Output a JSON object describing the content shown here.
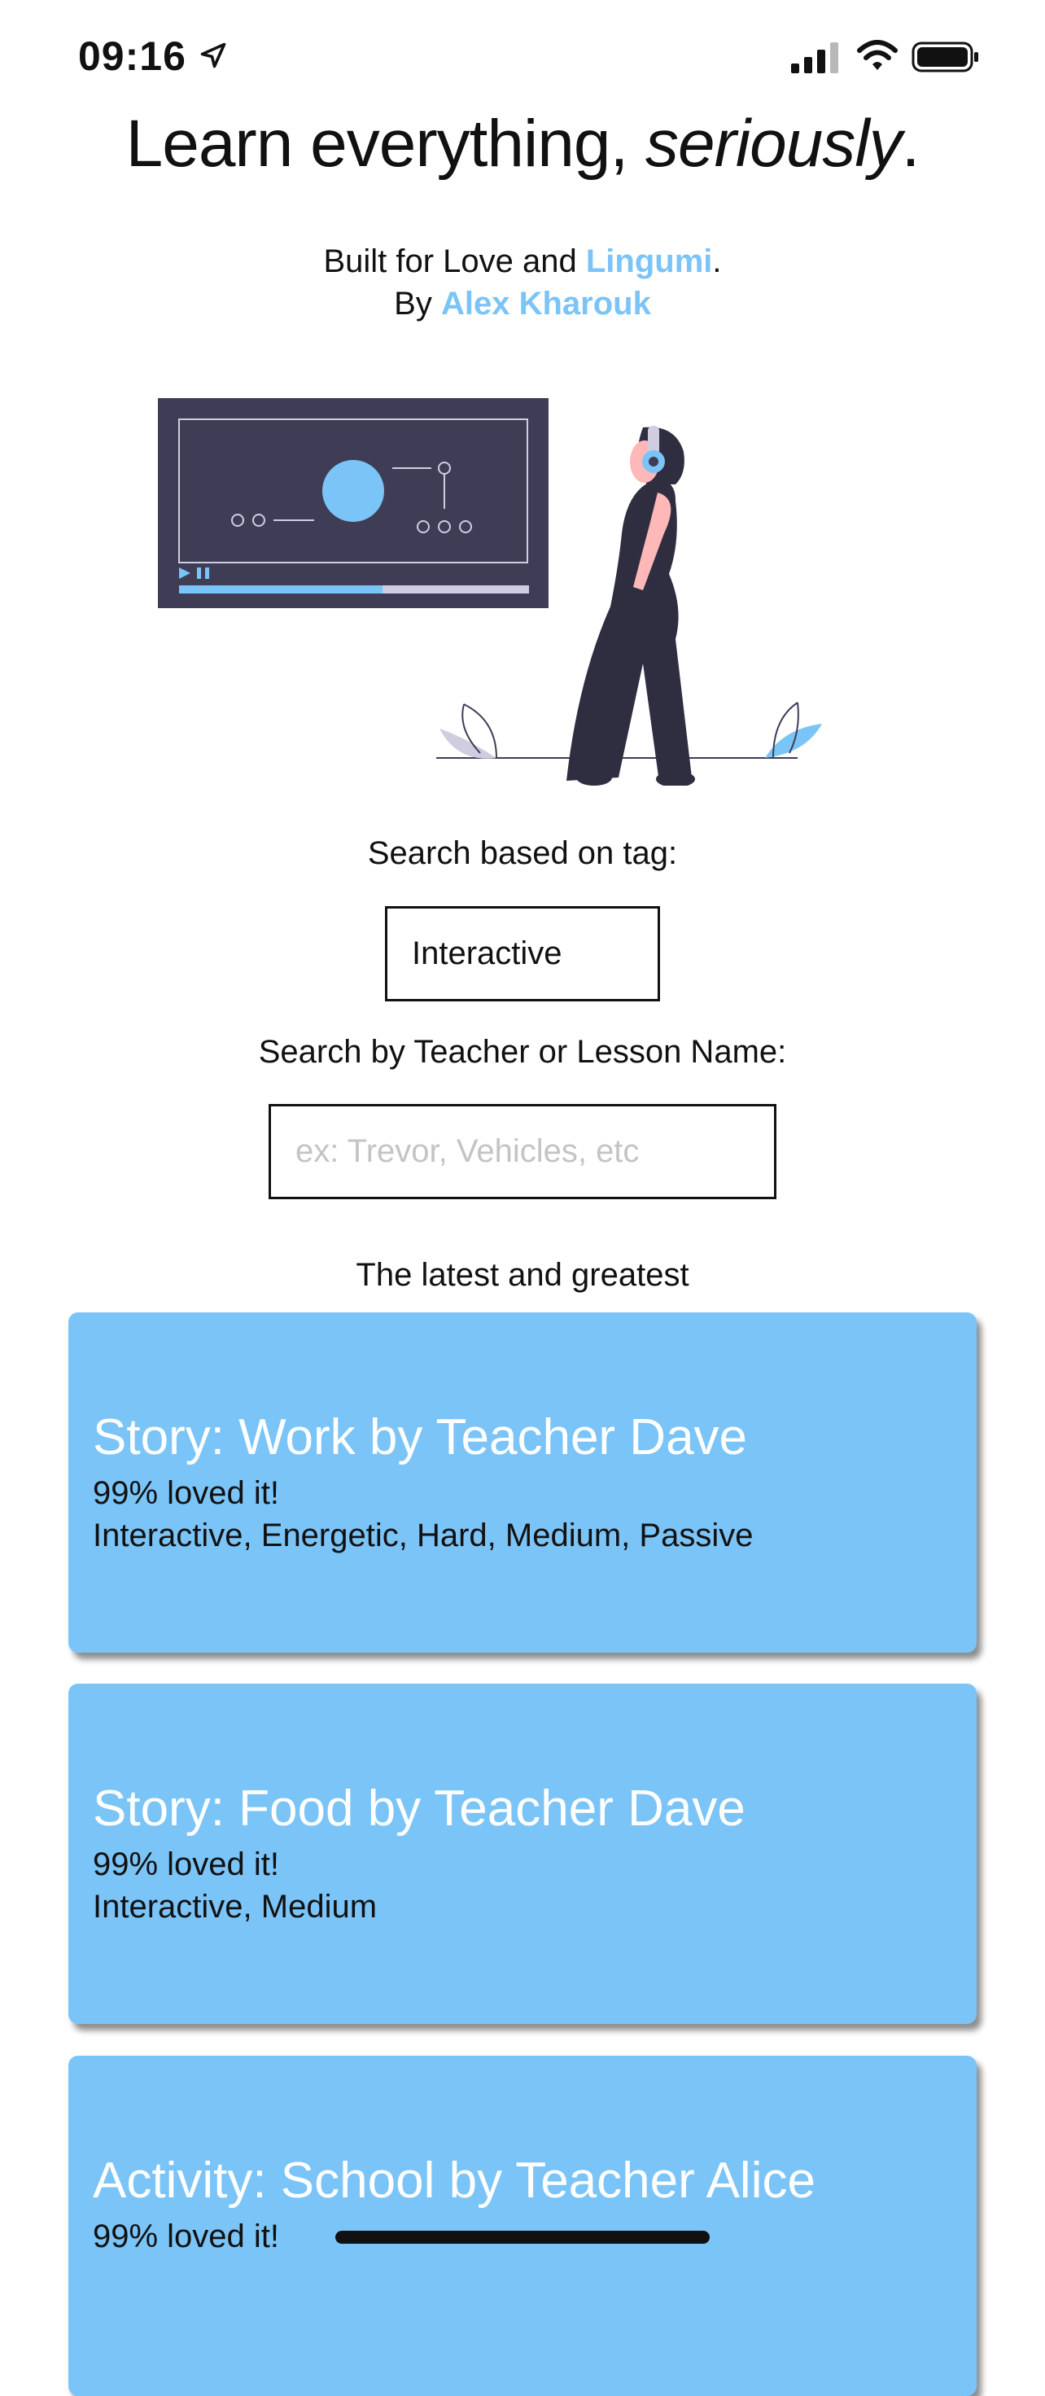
{
  "status": {
    "time": "09:16"
  },
  "header": {
    "title_main": "Learn everything, ",
    "title_italic": "seriously",
    "title_period": ".",
    "built_prefix": "Built for Love and ",
    "built_link": "Lingumi",
    "built_suffix": ".",
    "by_prefix": "By ",
    "by_link": "Alex Kharouk"
  },
  "search": {
    "tag_label": "Search based on tag:",
    "tag_value": "Interactive",
    "name_label": "Search by Teacher or Lesson Name:",
    "name_placeholder": "ex: Trevor, Vehicles, etc"
  },
  "section_title": "The latest and greatest",
  "lessons": [
    {
      "title": "Story: Work by Teacher Dave",
      "loved": "99% loved it!",
      "tags": "Interactive, Energetic, Hard, Medium, Passive"
    },
    {
      "title": "Story: Food by Teacher Dave",
      "loved": "99% loved it!",
      "tags": "Interactive, Medium"
    },
    {
      "title": "Activity: School by Teacher Alice",
      "loved": "99% loved it!",
      "tags": ""
    }
  ],
  "colors": {
    "accent": "#7bc4f7",
    "card": "#7bc4f7",
    "dark": "#3f3d56",
    "figure": "#2f2e41"
  },
  "icons": [
    "location-arrow-icon",
    "cellular-signal-icon",
    "wifi-icon",
    "battery-icon"
  ]
}
